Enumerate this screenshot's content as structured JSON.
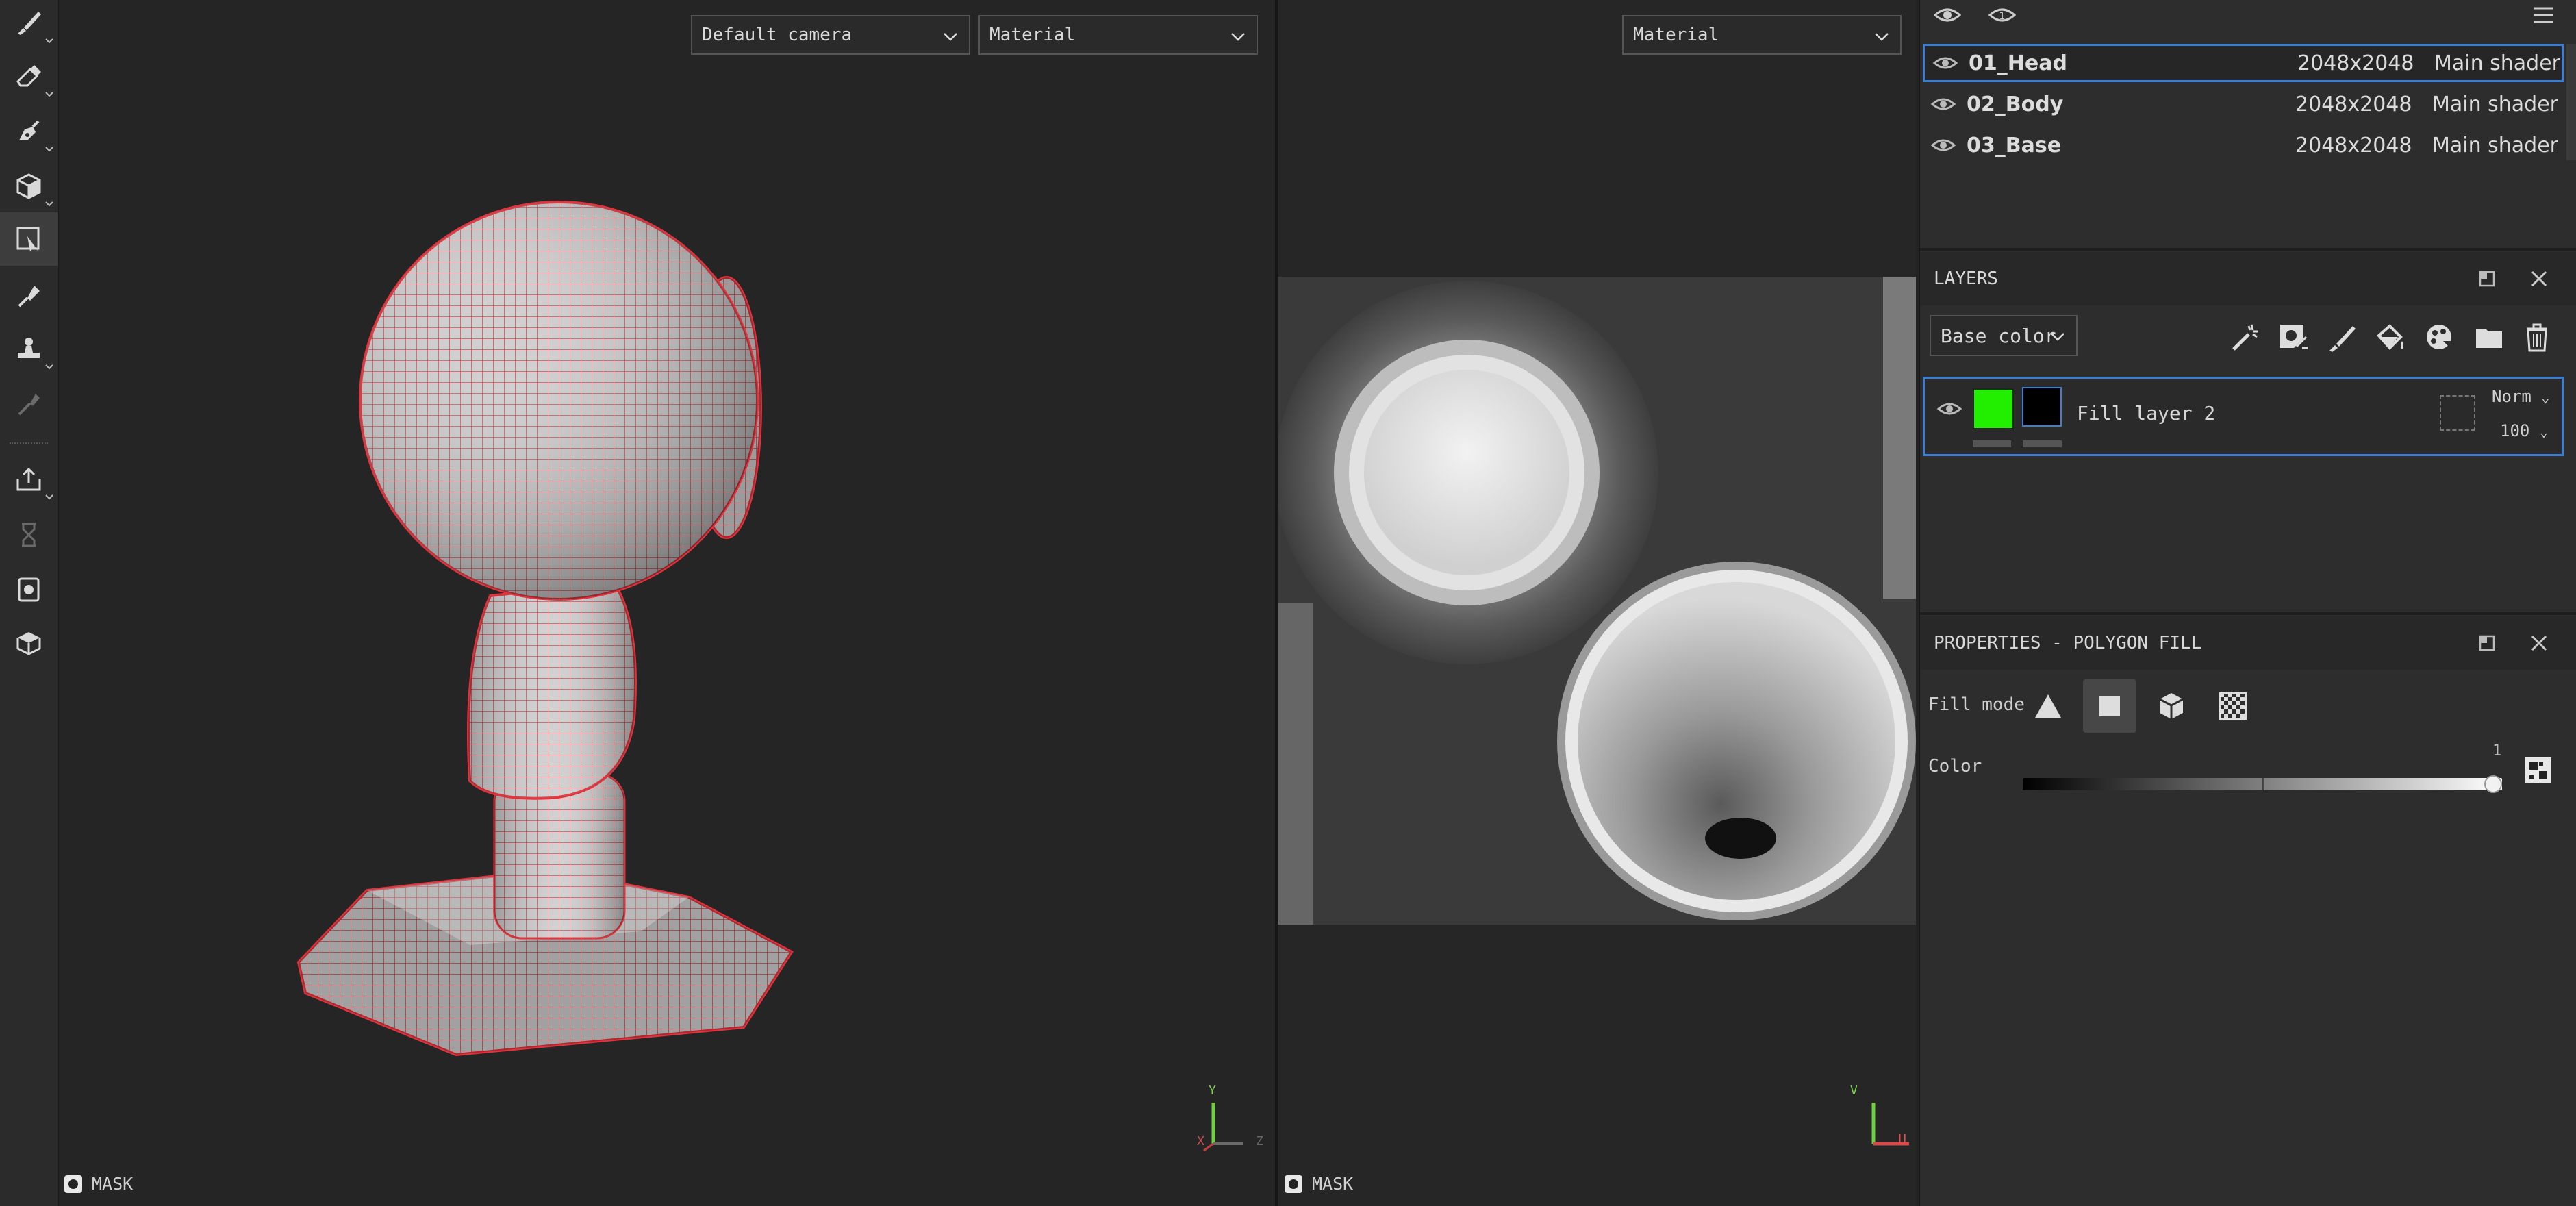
{
  "toolbar": {
    "tools": [
      {
        "name": "paint-brush-icon",
        "active": false
      },
      {
        "name": "eraser-icon",
        "active": false
      },
      {
        "name": "projection-icon",
        "active": false
      },
      {
        "name": "geometry-mask-icon",
        "active": false
      },
      {
        "name": "polygon-fill-icon",
        "active": true
      },
      {
        "name": "smudge-icon",
        "active": false
      },
      {
        "name": "clone-stamp-icon",
        "active": false
      },
      {
        "name": "color-picker-icon",
        "active": false
      },
      {
        "name": "export-icon",
        "active": false
      },
      {
        "name": "bake-icon",
        "active": false
      },
      {
        "name": "render-icon",
        "active": false
      },
      {
        "name": "shelf-icon",
        "active": false
      }
    ]
  },
  "viewport3d": {
    "camera_dropdown": "Default camera",
    "mode_dropdown": "Material",
    "mask_label": "MASK",
    "axis": {
      "y": "Y",
      "x": "X",
      "z": "Z"
    }
  },
  "viewport2d": {
    "mode_dropdown": "Material",
    "mask_label": "MASK",
    "axis": {
      "v": "V",
      "u": "U"
    }
  },
  "texture_sets": {
    "rows": [
      {
        "name": "01_Head",
        "resolution": "2048x2048",
        "shader": "Main shader",
        "selected": true
      },
      {
        "name": "02_Body",
        "resolution": "2048x2048",
        "shader": "Main shader",
        "selected": false
      },
      {
        "name": "03_Base",
        "resolution": "2048x2048",
        "shader": "Main shader",
        "selected": false
      }
    ]
  },
  "layers": {
    "title": "LAYERS",
    "channel_dropdown": "Base color",
    "layer": {
      "name": "Fill layer 2",
      "blend_mode": "Norm",
      "opacity": "100",
      "thumb_color": "#22ee00"
    }
  },
  "properties": {
    "title": "PROPERTIES - POLYGON FILL",
    "fill_mode_label": "Fill mode",
    "fill_mode_active": "quad",
    "color_label": "Color",
    "color_value": "1",
    "slider_fraction": 1.0
  },
  "colors": {
    "accent": "#3a7fd5",
    "wireframe": "#e0333d"
  }
}
